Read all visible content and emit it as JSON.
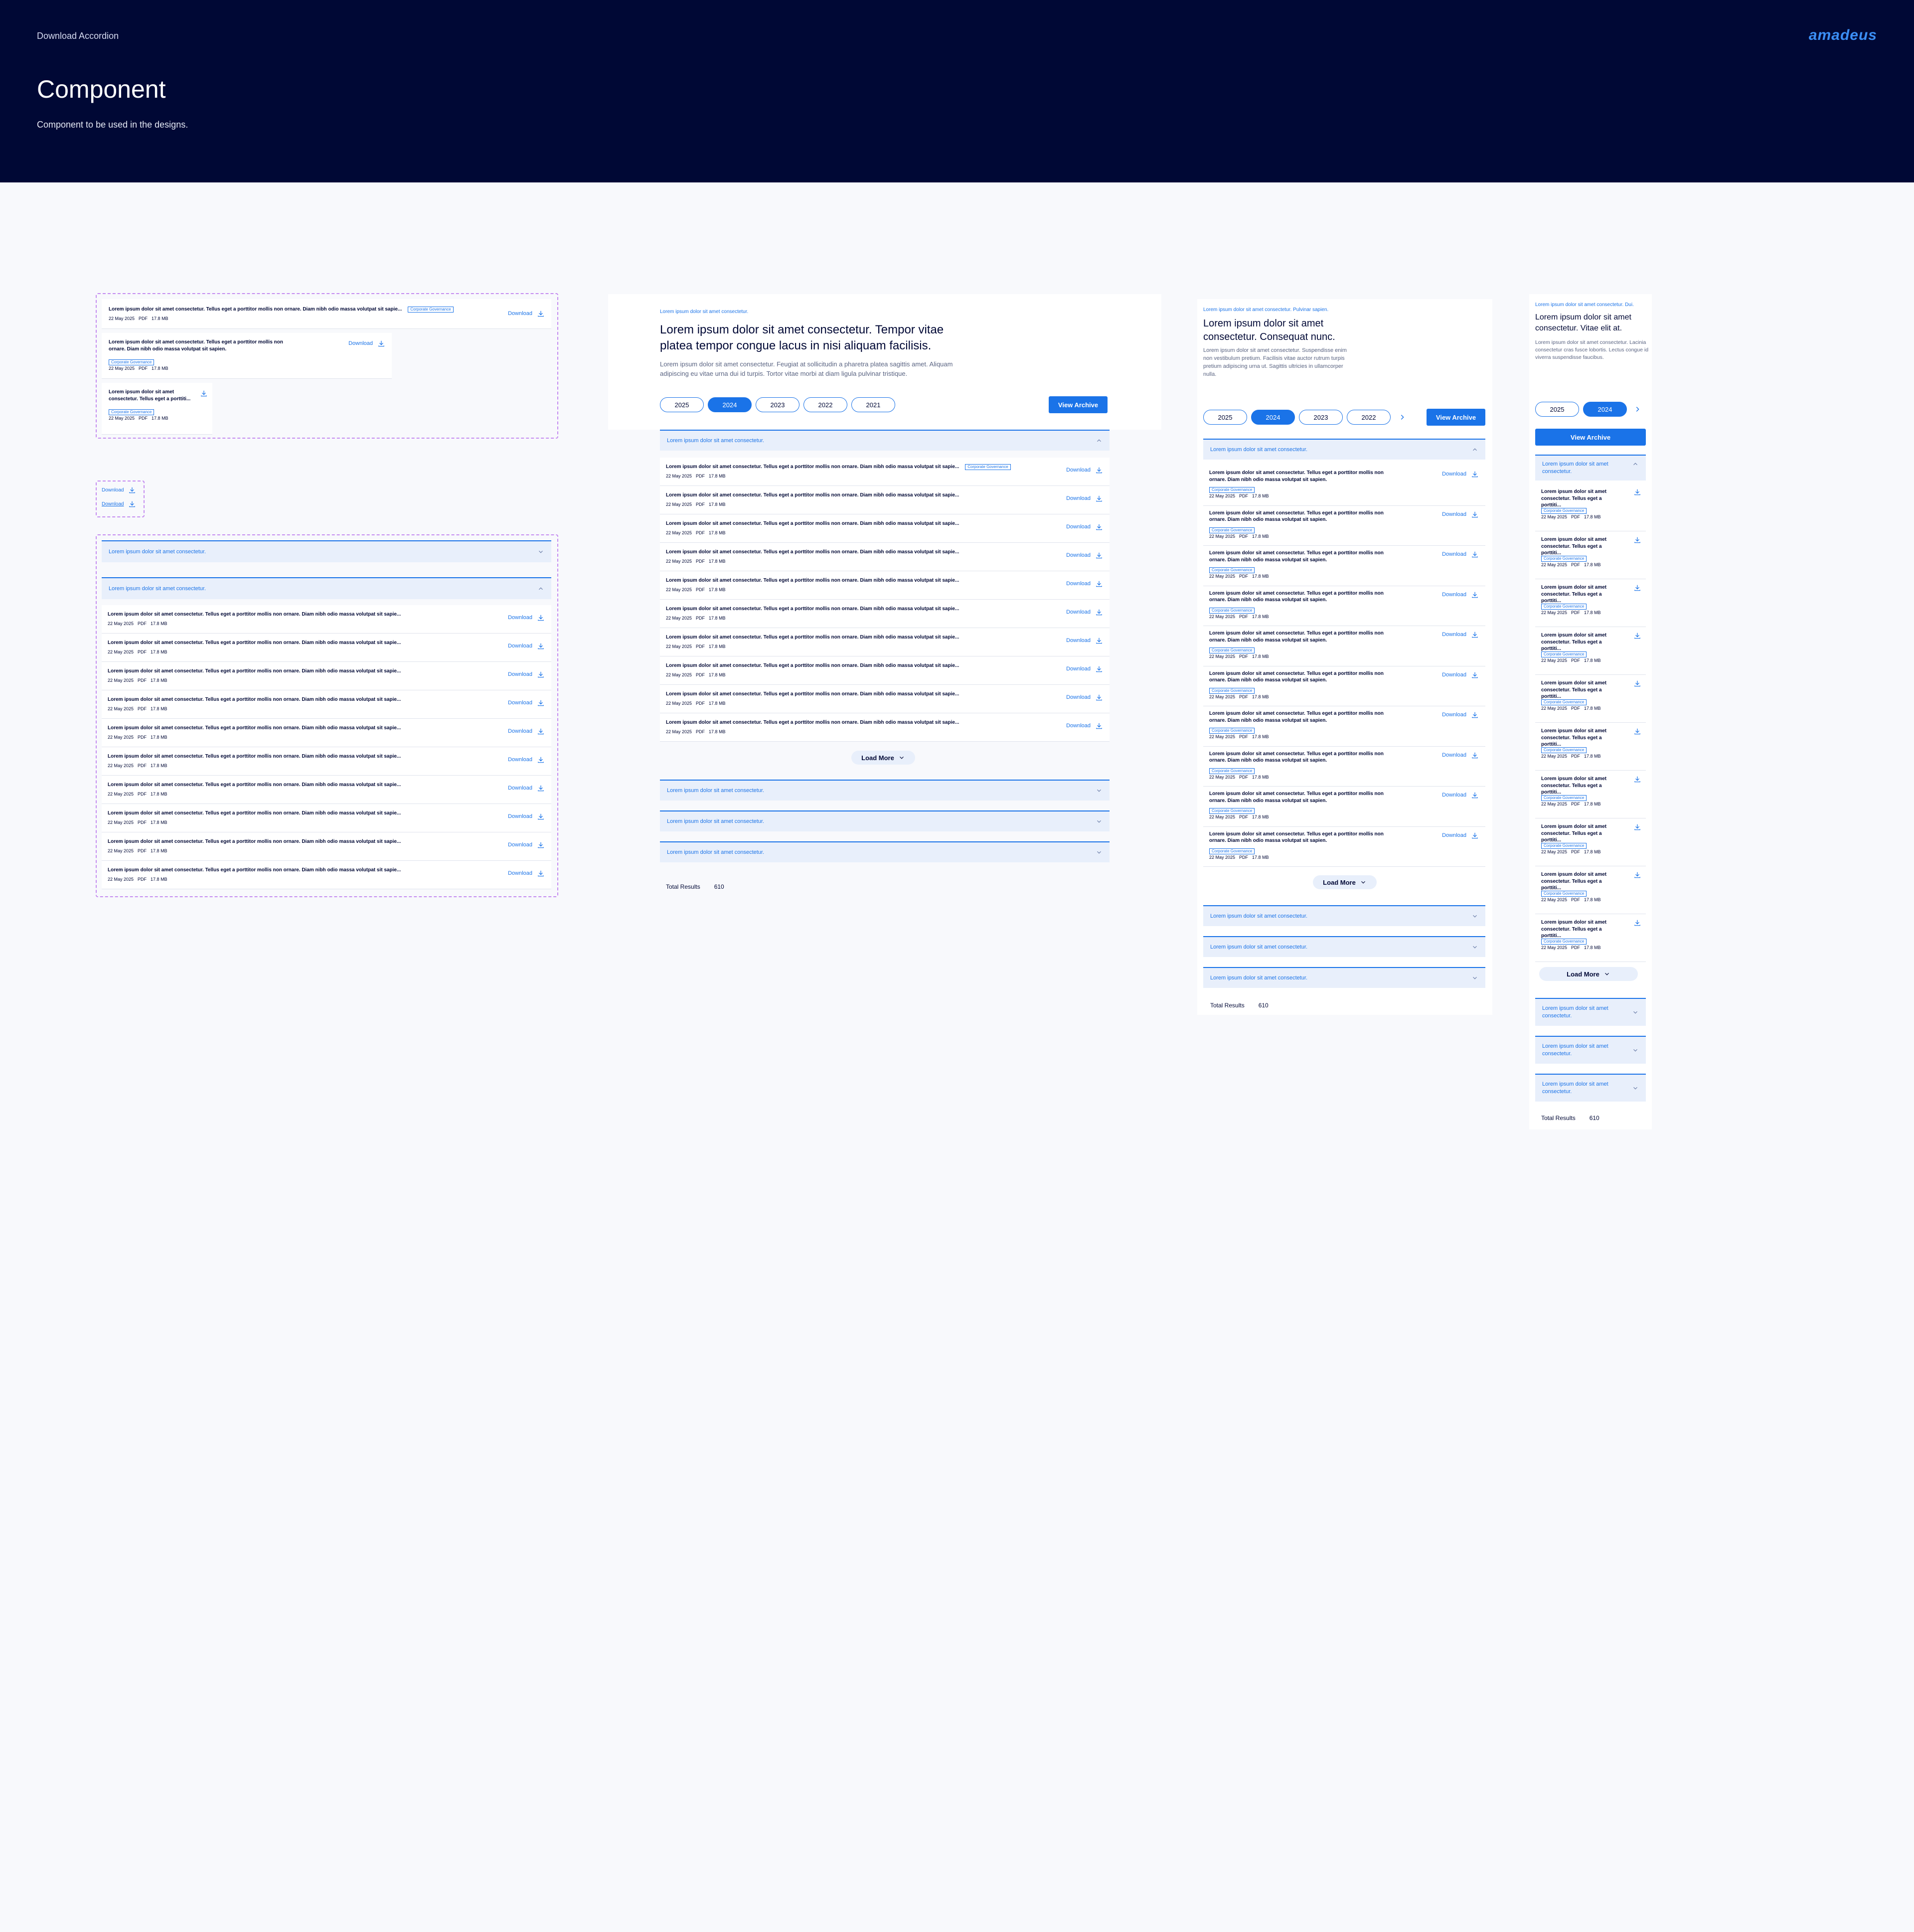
{
  "header": {
    "breadcrumb": "Download Accordion",
    "logo": "amadeus",
    "title": "Component",
    "subtitle": "Component to be used in the designs."
  },
  "common": {
    "item_title": "Lorem ipsum dolor sit amet consectetur. Tellus eget a porttitor mollis non ornare. Diam nibh odio massa volutpat sit sapie...",
    "item_title_2line": "Lorem ipsum dolor sit amet consectetur. Tellus eget a porttitor mollis non ornare. Diam nibh odio massa volutpat sit sapien.",
    "item_title_short": "Lorem ipsum dolor sit amet consectetur. Tellus eget a porttiti...",
    "date": "22 May 2025",
    "format": "PDF",
    "size": "17.8 MB",
    "tag": "Corporate Governance",
    "download": "Download",
    "accordion_label": "Lorem ipsum dolor sit amet consectetur.",
    "load_more": "Load More",
    "total_label": "Total Results",
    "total_value": "610",
    "view_archive": "View Archive",
    "years": [
      "2025",
      "2024",
      "2023",
      "2022",
      "2021"
    ]
  },
  "desktop": {
    "eyebrow": "Lorem ipsum dolor sit amet consectetur.",
    "title": "Lorem ipsum dolor sit amet consectetur. Tempor vitae platea tempor congue lacus in nisi aliquam facilisis.",
    "description": "Lorem ipsum dolor sit amet consectetur. Feugiat at sollicitudin a pharetra platea sagittis amet. Aliquam adipiscing eu vitae urna dui id turpis. Tortor vitae morbi at diam ligula pulvinar tristique."
  },
  "tablet": {
    "eyebrow": "Lorem ipsum dolor sit amet consectetur. Pulvinar sapien.",
    "title": "Lorem ipsum dolor sit amet consectetur. Consequat nunc.",
    "description": "Lorem ipsum dolor sit amet consectetur. Suspendisse enim non vestibulum pretium. Facilisis vitae auctor rutrum turpis pretium adipiscing urna ut. Sagittis ultricies in ullamcorper nulla."
  },
  "mobile": {
    "eyebrow": "Lorem ipsum dolor sit amet consectetur. Dui.",
    "title": "Lorem ipsum dolor sit amet consectetur. Vitae elit at.",
    "description": "Lorem ipsum dolor sit amet consectetur. Lacinia consectetur cras fusce lobortis. Lectus congue id viverra suspendisse faucibus.",
    "accordion_label": "Lorem ipsum dolor sit amet consectetur.",
    "item_title": "Lorem ipsum dolor sit amet consectetur. Tellus eget a porttiti..."
  },
  "colors": {
    "navy": "#000835",
    "brand_blue": "#1a73e8",
    "accordion_bg": "#e8effb",
    "component_outline": "#c58cf0",
    "page_bg": "#f8f9fc"
  }
}
